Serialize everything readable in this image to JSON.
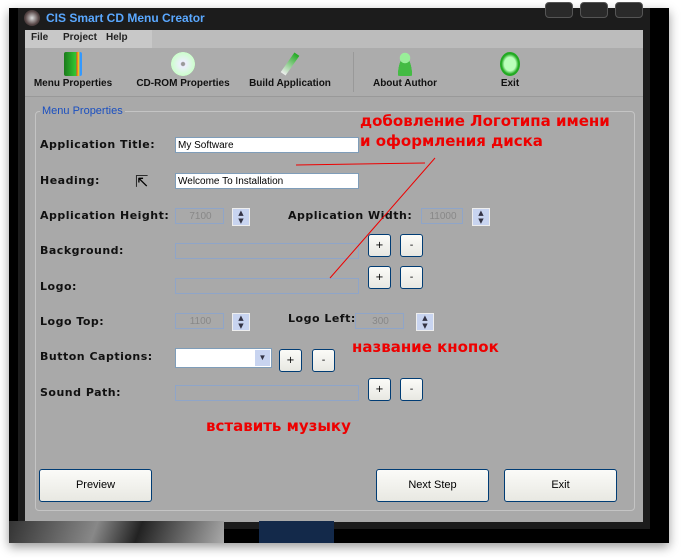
{
  "window": {
    "title": "CIS Smart CD Menu Creator"
  },
  "menu": [
    "File",
    "Project",
    "Help"
  ],
  "toolbar": [
    {
      "label": "Menu Properties",
      "icon": "book-icon"
    },
    {
      "label": "CD-ROM Properties",
      "icon": "cd-icon"
    },
    {
      "label": "Build Application",
      "icon": "screwdriver-icon"
    },
    {
      "label": "About Author",
      "icon": "user-icon"
    },
    {
      "label": "Exit",
      "icon": "exit-icon"
    }
  ],
  "form": {
    "group_label": "Menu Properties",
    "app_title_label": "Application Title:",
    "app_title_value": "My Software",
    "heading_label": "Heading:",
    "heading_value": "Welcome To Installation",
    "height_label": "Application Height:",
    "height_value": "7100",
    "width_label": "Application Width:",
    "width_value": "11000",
    "background_label": "Background:",
    "logo_label": "Logo:",
    "logo_top_label": "Logo Top:",
    "logo_top_value": "1100",
    "logo_left_label": "Logo Left:",
    "logo_left_value": "300",
    "captions_label": "Button Captions:",
    "sound_label": "Sound Path:",
    "plus": "+",
    "minus": "-"
  },
  "buttons": {
    "preview": "Preview",
    "next": "Next Step",
    "exit": "Exit"
  },
  "annotations": [
    "добовление Логотипа  имени",
    "и оформления  диска",
    "название кнопок",
    "вставить музыку"
  ],
  "colors": {
    "annotation": "#ee0000",
    "title": "#5aa8ff"
  }
}
